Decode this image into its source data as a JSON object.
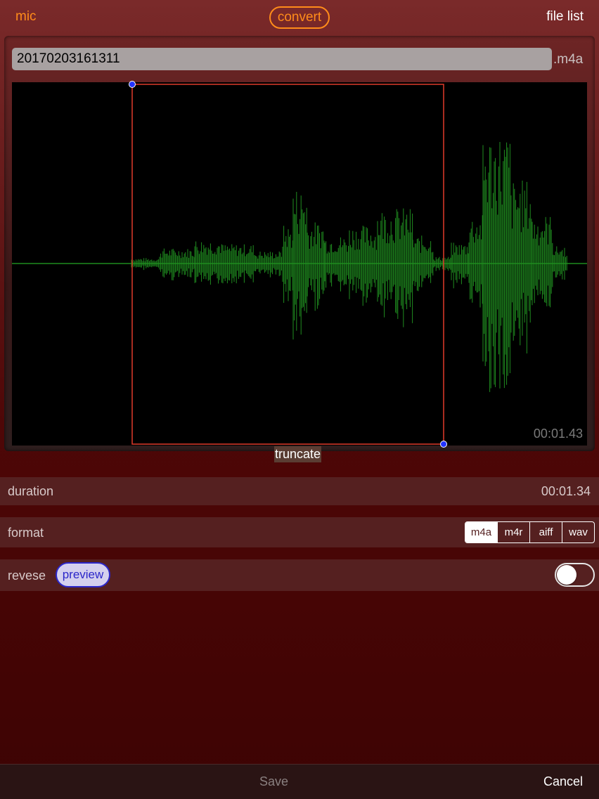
{
  "nav": {
    "left": "mic",
    "center": "convert",
    "right": "file list"
  },
  "file": {
    "name": "20170203161311",
    "ext": ".m4a"
  },
  "waveform": {
    "time": "00:01.43",
    "wave_color": "#1f8c1f",
    "selection_color": "#e03a2a",
    "handle_color": "#2233ff"
  },
  "truncate_label": "truncate",
  "duration": {
    "label": "duration",
    "value": "00:01.34"
  },
  "format": {
    "label": "format",
    "options": [
      "m4a",
      "m4r",
      "aiff",
      "wav"
    ],
    "selected": "m4a"
  },
  "reverse": {
    "label": "revese",
    "preview": "preview",
    "toggle_on": false
  },
  "bottom": {
    "save": "Save",
    "cancel": "Cancel"
  },
  "colors": {
    "accent": "#ff8c1a",
    "background": "#4e0707"
  }
}
